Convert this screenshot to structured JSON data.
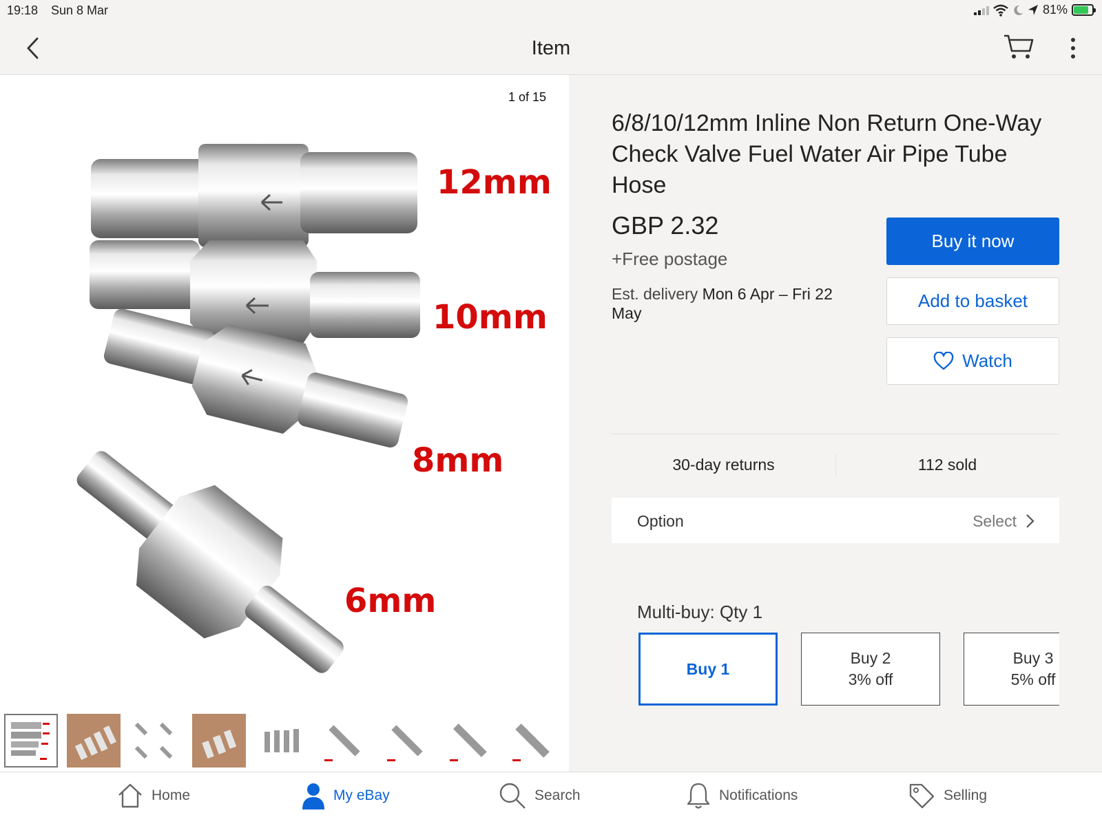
{
  "status_bar": {
    "time": "19:18",
    "date": "Sun 8 Mar",
    "battery": "81%"
  },
  "header": {
    "title": "Item"
  },
  "gallery": {
    "counter": "1 of 15",
    "size_labels": [
      "12mm",
      "10mm",
      "8mm",
      "6mm"
    ]
  },
  "item": {
    "title": "6/8/10/12mm Inline Non Return One-Way Check Valve Fuel Water Air Pipe Tube Hose",
    "price": "GBP 2.32",
    "postage": "+Free postage",
    "delivery_label": "Est. delivery",
    "delivery_value": "Mon 6 Apr – Fri 22 May",
    "returns": "30-day returns",
    "sold": "112 sold"
  },
  "actions": {
    "buy_now": "Buy it now",
    "add_basket": "Add to basket",
    "watch": "Watch"
  },
  "option": {
    "label": "Option",
    "value": "Select"
  },
  "multibuy": {
    "label": "Multi-buy: Qty 1",
    "options": [
      {
        "title": "Buy 1",
        "discount": ""
      },
      {
        "title": "Buy 2",
        "discount": "3% off"
      },
      {
        "title": "Buy 3",
        "discount": "5% off"
      }
    ]
  },
  "nav": {
    "home": "Home",
    "myebay": "My eBay",
    "search": "Search",
    "notifications": "Notifications",
    "selling": "Selling"
  },
  "colors": {
    "accent": "#0b64d8",
    "label_red": "#d40b0b"
  }
}
